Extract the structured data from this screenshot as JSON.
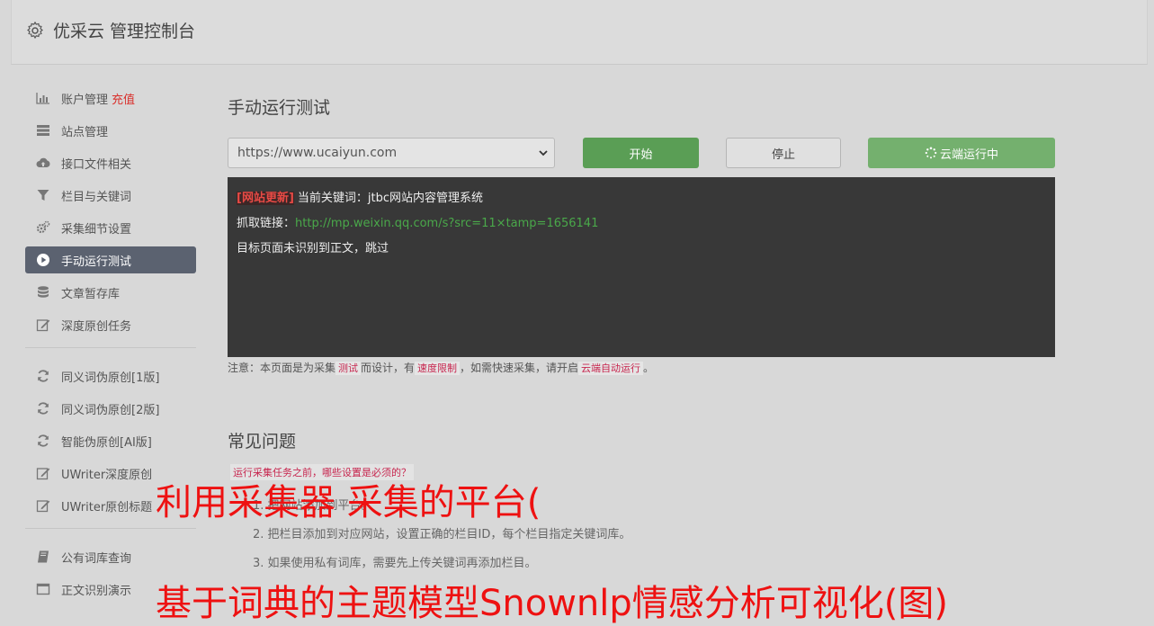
{
  "header": {
    "title": "优采云 管理控制台"
  },
  "sidebar": {
    "group1": [
      {
        "label": "账户管理",
        "extra": "充值",
        "icon": "bar-chart-icon"
      },
      {
        "label": "站点管理",
        "icon": "server-icon"
      },
      {
        "label": "接口文件相关",
        "icon": "cloud-upload-icon"
      },
      {
        "label": "栏目与关键词",
        "icon": "filter-icon"
      },
      {
        "label": "采集细节设置",
        "icon": "cogs-icon"
      },
      {
        "label": "手动运行测试",
        "icon": "play-circle-icon",
        "active": true
      },
      {
        "label": "文章暂存库",
        "icon": "database-icon"
      },
      {
        "label": "深度原创任务",
        "icon": "edit-icon"
      }
    ],
    "group2": [
      {
        "label": "同义词伪原创[1版]",
        "icon": "refresh-icon"
      },
      {
        "label": "同义词伪原创[2版]",
        "icon": "refresh-icon"
      },
      {
        "label": "智能伪原创[AI版]",
        "icon": "refresh-icon"
      },
      {
        "label": "UWriter深度原创",
        "icon": "edit-icon"
      },
      {
        "label": "UWriter原创标题",
        "icon": "edit-icon"
      }
    ],
    "group3": [
      {
        "label": "公有词库查询",
        "icon": "book-icon"
      },
      {
        "label": "正文识别演示",
        "icon": "window-icon"
      }
    ]
  },
  "main": {
    "title": "手动运行测试",
    "url_select": "https://www.ucaiyun.com",
    "buttons": {
      "start": "开始",
      "stop": "停止",
      "cloud": "云端运行中"
    },
    "console": {
      "tag": "[网站更新]",
      "keyword_label": "当前关键词：",
      "keyword": "jtbc网站内容管理系统",
      "link_label": "抓取链接：",
      "link": "http://mp.weixin.qq.com/s?src=11×tamp=1656141",
      "result": "目标页面未识别到正文，跳过"
    },
    "notice": {
      "p1": "注意：本页面是为采集",
      "c1": "测试",
      "p2": "而设计，有",
      "c2": "速度限制",
      "p3": "，如需快速采集，请开启",
      "c3": "云端自动运行",
      "p4": "。"
    },
    "faq": {
      "title": "常见问题",
      "question": "运行采集任务之前，哪些设置是必须的？",
      "step1": "1. 把网站添加到平台。",
      "step2": "2. 把栏目添加到对应网站，设置正确的栏目ID，每个栏目指定关键词库。",
      "step3": "3. 如果使用私有词库，需要先上传关键词再添加栏目。"
    }
  },
  "overlay": {
    "line1": "利用采集器 采集的平台(",
    "line2": "基于词典的主题模型Snownlp情感分析可视化(图)"
  },
  "colors": {
    "accent_green": "#5a9e55",
    "active_nav": "#5b6270",
    "overlay_red": "#ee1111"
  }
}
